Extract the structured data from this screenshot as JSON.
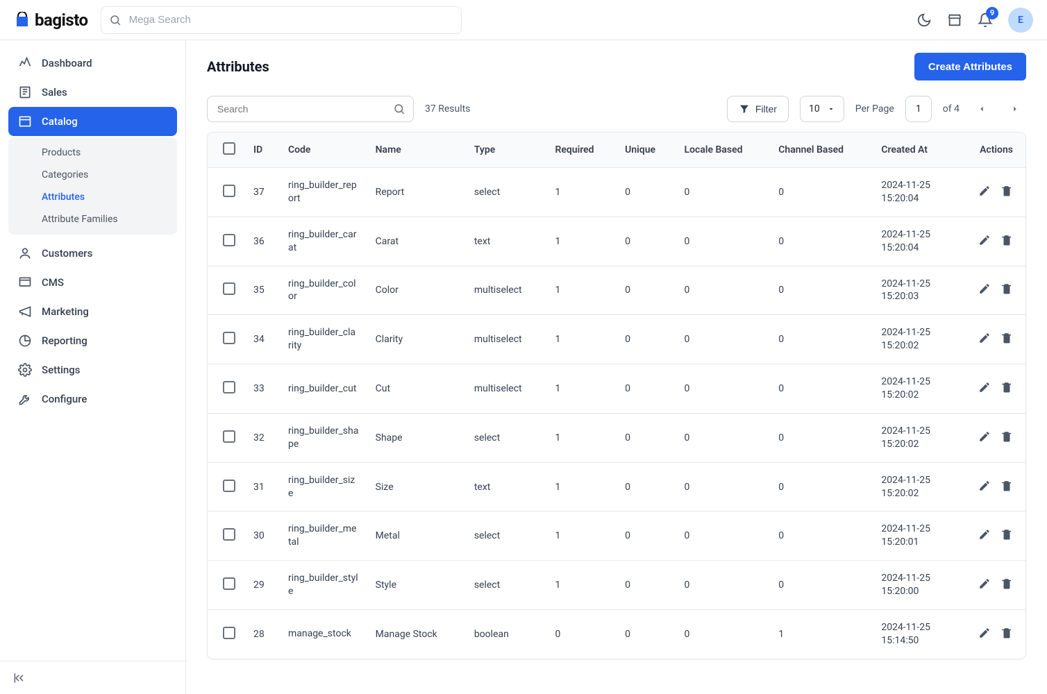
{
  "brand": "bagisto",
  "search": {
    "placeholder": "Mega Search"
  },
  "notifications": {
    "count": 9
  },
  "avatar": {
    "initial": "E"
  },
  "sidebar": {
    "items": [
      {
        "label": "Dashboard"
      },
      {
        "label": "Sales"
      },
      {
        "label": "Catalog"
      },
      {
        "label": "Customers"
      },
      {
        "label": "CMS"
      },
      {
        "label": "Marketing"
      },
      {
        "label": "Reporting"
      },
      {
        "label": "Settings"
      },
      {
        "label": "Configure"
      }
    ],
    "catalog_sub": [
      {
        "label": "Products"
      },
      {
        "label": "Categories"
      },
      {
        "label": "Attributes"
      },
      {
        "label": "Attribute Families"
      }
    ]
  },
  "page": {
    "title": "Attributes",
    "create_btn": "Create Attributes"
  },
  "toolbar": {
    "search_placeholder": "Search",
    "results": "37 Results",
    "filter": "Filter",
    "per_page_value": "10",
    "per_page_label": "Per Page",
    "page_current": "1",
    "of_label": "of",
    "page_total": "4"
  },
  "columns": {
    "id": "ID",
    "code": "Code",
    "name": "Name",
    "type": "Type",
    "required": "Required",
    "unique": "Unique",
    "locale": "Locale Based",
    "channel": "Channel Based",
    "created": "Created At",
    "actions": "Actions"
  },
  "rows": [
    {
      "id": "37",
      "code": "ring_builder_report",
      "name": "Report",
      "type": "select",
      "required": "1",
      "unique": "0",
      "locale": "0",
      "channel": "0",
      "created": "2024-11-25 15:20:04"
    },
    {
      "id": "36",
      "code": "ring_builder_carat",
      "name": "Carat",
      "type": "text",
      "required": "1",
      "unique": "0",
      "locale": "0",
      "channel": "0",
      "created": "2024-11-25 15:20:04"
    },
    {
      "id": "35",
      "code": "ring_builder_color",
      "name": "Color",
      "type": "multiselect",
      "required": "1",
      "unique": "0",
      "locale": "0",
      "channel": "0",
      "created": "2024-11-25 15:20:03"
    },
    {
      "id": "34",
      "code": "ring_builder_clarity",
      "name": "Clarity",
      "type": "multiselect",
      "required": "1",
      "unique": "0",
      "locale": "0",
      "channel": "0",
      "created": "2024-11-25 15:20:02"
    },
    {
      "id": "33",
      "code": "ring_builder_cut",
      "name": "Cut",
      "type": "multiselect",
      "required": "1",
      "unique": "0",
      "locale": "0",
      "channel": "0",
      "created": "2024-11-25 15:20:02"
    },
    {
      "id": "32",
      "code": "ring_builder_shape",
      "name": "Shape",
      "type": "select",
      "required": "1",
      "unique": "0",
      "locale": "0",
      "channel": "0",
      "created": "2024-11-25 15:20:02"
    },
    {
      "id": "31",
      "code": "ring_builder_size",
      "name": "Size",
      "type": "text",
      "required": "1",
      "unique": "0",
      "locale": "0",
      "channel": "0",
      "created": "2024-11-25 15:20:02"
    },
    {
      "id": "30",
      "code": "ring_builder_metal",
      "name": "Metal",
      "type": "select",
      "required": "1",
      "unique": "0",
      "locale": "0",
      "channel": "0",
      "created": "2024-11-25 15:20:01"
    },
    {
      "id": "29",
      "code": "ring_builder_style",
      "name": "Style",
      "type": "select",
      "required": "1",
      "unique": "0",
      "locale": "0",
      "channel": "0",
      "created": "2024-11-25 15:20:00"
    },
    {
      "id": "28",
      "code": "manage_stock",
      "name": "Manage Stock",
      "type": "boolean",
      "required": "0",
      "unique": "0",
      "locale": "0",
      "channel": "1",
      "created": "2024-11-25 15:14:50"
    }
  ]
}
